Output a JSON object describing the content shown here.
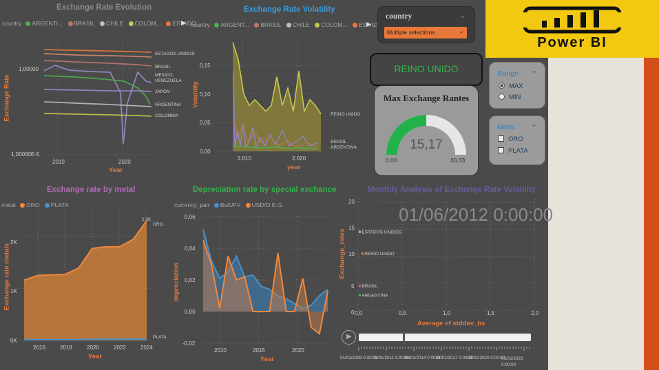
{
  "brand": {
    "logo_text": "Power BI",
    "colors": {
      "yellow": "#f2c811",
      "orange": "#d34f1a",
      "bg": "#4a4a4a"
    }
  },
  "country_slicer": {
    "title": "country",
    "value": "Multiple selections",
    "icon": "chevron-down-icon"
  },
  "selected_country_card": {
    "value": "REINO UNIDO"
  },
  "gauge": {
    "title": "Max Exchange Rantes",
    "value": "15,17",
    "min_label": "0,00",
    "max_label": "30,33",
    "min": 0,
    "max": 30.33,
    "current": 15.17
  },
  "range_slicer": {
    "title": "Range",
    "options": [
      {
        "label": "MAX",
        "selected": true
      },
      {
        "label": "MIN",
        "selected": false
      }
    ]
  },
  "metal_slicer": {
    "title": "Metal",
    "options": [
      {
        "label": "ORO",
        "checked": false
      },
      {
        "label": "PLATA",
        "checked": false
      }
    ]
  },
  "chart_data": [
    {
      "id": "evolution",
      "type": "line",
      "title": "Exchange Rate Evolution",
      "legend_title": "country",
      "legend": [
        {
          "name": "ARGENTI...",
          "color": "#4caf50"
        },
        {
          "name": "BRASIL",
          "color": "#c0786a"
        },
        {
          "name": "CHILE",
          "color": "#bdbdbd"
        },
        {
          "name": "COLOM...",
          "color": "#c8c850"
        },
        {
          "name": "ESTADO...",
          "color": "#e8793a"
        }
      ],
      "xlabel": "Year",
      "ylabel": "Exchange Rate",
      "y_scale": "log",
      "y_ticks": [
        "1,00000",
        "1,00000E-5"
      ],
      "x_ticks": [
        "2010",
        "2020"
      ],
      "series_labels": [
        "ESTADOS UNIDOS",
        "BRASIL",
        "MEXICO",
        "VENEZUELA",
        "JAPON",
        "ARGENTINA",
        "COLOMBIA"
      ]
    },
    {
      "id": "volatility",
      "type": "area",
      "title": "Exchange Rate Volatility",
      "legend_title": "country",
      "legend": [
        {
          "name": "ARGENT...",
          "color": "#4caf50"
        },
        {
          "name": "BRASIL",
          "color": "#c0786a"
        },
        {
          "name": "CHILE",
          "color": "#bdbdbd"
        },
        {
          "name": "COLOM...",
          "color": "#c8c850"
        },
        {
          "name": "ESTADO...",
          "color": "#e8793a"
        }
      ],
      "xlabel": "year",
      "ylabel": "Volatility",
      "ylim": [
        0,
        0.15
      ],
      "y_ticks": [
        "0,15",
        "0,10",
        "0,05",
        "0,00"
      ],
      "x_ticks": [
        "2.010",
        "2.020"
      ],
      "x": [
        2008,
        2009,
        2010,
        2011,
        2012,
        2013,
        2014,
        2015,
        2016,
        2017,
        2018,
        2019,
        2020,
        2021,
        2022,
        2023,
        2024
      ],
      "series": [
        {
          "name": "COLOMBIA",
          "values": [
            0.19,
            0.16,
            0.1,
            0.08,
            0.09,
            0.08,
            0.07,
            0.08,
            0.13,
            0.08,
            0.11,
            0.07,
            0.14,
            0.07,
            0.09,
            0.08,
            0.065
          ]
        }
      ],
      "series_labels": [
        "REINO UNIDO",
        "BRASIL",
        "ARGENTINA"
      ]
    },
    {
      "id": "metal",
      "type": "area",
      "title": "Exchange rate by metal",
      "legend_title": "metal",
      "legend": [
        {
          "name": "ORO",
          "color": "#f0883e"
        },
        {
          "name": "PLATA",
          "color": "#4a90c8"
        }
      ],
      "xlabel": "Year",
      "ylabel": "Exchange rate metals",
      "y_ticks": [
        "2K",
        "1K",
        "0K"
      ],
      "x_ticks": [
        "2016",
        "2018",
        "2020",
        "2022",
        "2024"
      ],
      "ylim": [
        0,
        2500
      ],
      "x": [
        2015,
        2016,
        2017,
        2018,
        2019,
        2020,
        2021,
        2022,
        2023,
        2024
      ],
      "series": [
        {
          "name": "ORO",
          "values": [
            1160,
            1250,
            1260,
            1270,
            1390,
            1770,
            1800,
            1800,
            1940,
            2300
          ]
        },
        {
          "name": "PLATA",
          "values": [
            15,
            17,
            17,
            16,
            17,
            21,
            25,
            22,
            23,
            28
          ]
        }
      ],
      "data_labels": [
        "2,3K",
        "ORO",
        "PLATA"
      ]
    },
    {
      "id": "depreciation",
      "type": "area",
      "title": "Depreciation rate by special exchance",
      "legend_title": "currency_pair",
      "legend": [
        {
          "name": "Bs/UFV",
          "color": "#4a90c8"
        },
        {
          "name": "USD/O.E.G.",
          "color": "#f0883e"
        }
      ],
      "xlabel": "Year",
      "ylabel": "depreciation",
      "ylim": [
        -0.02,
        0.06
      ],
      "y_ticks": [
        "0,06",
        "0,04",
        "0,02",
        "0,00",
        "-0,02"
      ],
      "x_ticks": [
        "2010",
        "2015",
        "2020"
      ],
      "x": [
        2008,
        2009,
        2010,
        2011,
        2012,
        2013,
        2014,
        2015,
        2016,
        2017,
        2018,
        2019,
        2020,
        2021,
        2022,
        2023
      ],
      "series": [
        {
          "name": "Bs/UFV",
          "values": [
            0.052,
            0.032,
            0.021,
            0.025,
            0.035,
            0.022,
            0.023,
            0.016,
            0.014,
            0.01,
            0.008,
            0.005,
            0.002,
            0.004,
            0.01,
            0.014
          ]
        },
        {
          "name": "USD/O.E.G.",
          "values": [
            0.045,
            0.03,
            0.002,
            0.035,
            0.02,
            0.022,
            0.0,
            0.0,
            0.0,
            0.037,
            0.0,
            0.0,
            0.021,
            -0.01,
            -0.014,
            0.013
          ]
        }
      ]
    },
    {
      "id": "monthly",
      "type": "scatter",
      "title": "Monthly Analysis of Exchange Rate Volatility",
      "xlabel": "Average of stddev_bs",
      "ylabel": "Exchange_rates",
      "xlim": [
        0,
        2
      ],
      "ylim": [
        0,
        20
      ],
      "x_ticks": [
        "0,0",
        "0,5",
        "1,0",
        "1,5",
        "2,0"
      ],
      "y_ticks": [
        "20",
        "15",
        "10",
        "5",
        "0"
      ],
      "play_axis_value": "01/06/2012 0:00:00",
      "points": [
        {
          "label": "ESTADOS UNIDOS",
          "x": 0.02,
          "y": 14.5
        },
        {
          "label": "REINO UNIDO",
          "x": 0.05,
          "y": 10.5
        },
        {
          "label": "BRASIL",
          "x": 0.02,
          "y": 4.5
        },
        {
          "label": "ARGENTINA",
          "x": 0.02,
          "y": 2.8
        }
      ],
      "timeline_ticks": [
        "01/01/2008 0:00:00",
        "01/01/2011 0:00:00",
        "01/01/2014 0:00:00",
        "01/01/2017 0:00:00",
        "01/01/2020 0:00:00",
        "01/01/2023 0:00:00"
      ]
    }
  ]
}
